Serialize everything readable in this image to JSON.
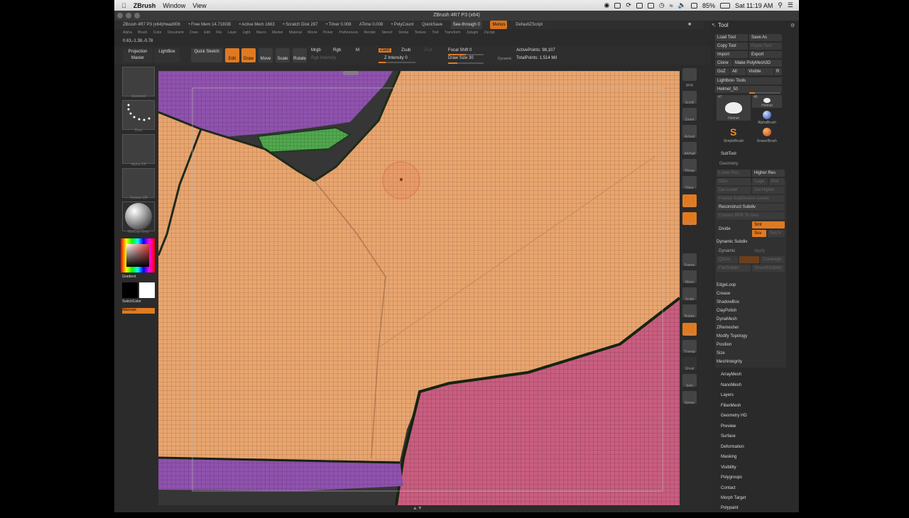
{
  "mac_menubar": {
    "app_name": "ZBrush",
    "menus": [
      "Window",
      "View"
    ],
    "battery": "85%",
    "clock": "Sat 11:19 AM"
  },
  "window": {
    "title": "ZBrush 4R7 P3 (x64)"
  },
  "infobar": {
    "version": "ZBrush 4R7 P3 (x64)Head006",
    "free_mem": "• Free Mem 14.718GB",
    "active_mem": "• Active Mem 1663",
    "scratch": "• Scratch Disk 287",
    "timer": "• Timer 0.008",
    "atime": "ATime 0.008",
    "polycount": "• PolyCount",
    "quicksave": "QuickSave",
    "see_through": "See-through 0",
    "menus_btn": "Menus",
    "default_script": "DefaultZScript"
  },
  "menus": [
    "Alpha",
    "Brush",
    "Color",
    "Document",
    "Draw",
    "Edit",
    "File",
    "Layer",
    "Light",
    "Macro",
    "Marker",
    "Material",
    "Movie",
    "Picker",
    "Preferences",
    "Render",
    "Stencil",
    "Stroke",
    "Texture",
    "Tool",
    "Transform",
    "Zplugin",
    "Zscript"
  ],
  "coords": "0.63,-1.38,-0.78",
  "shelf": {
    "projection_master": "Projection Master",
    "lightbox": "LightBox",
    "quick_sketch": "Quick Sketch",
    "edit": "Edit",
    "draw": "Draw",
    "move": "Move",
    "scale": "Scale",
    "rotate": "Rotate",
    "mrgb": "Mrgb",
    "rgb": "Rgb",
    "m": "M",
    "rgb_intensity": "Rgb Intensity",
    "zadd": "Zadd",
    "zsub": "Zsub",
    "zcut": "Zcut",
    "z_intensity": "Z Intensity 0",
    "focal_shift": "Focal Shift 0",
    "draw_size": "Draw Size 30",
    "dynamic": "Dynamic",
    "active_points": "ActivePoints: 98,107",
    "total_points": "TotalPoints: 1.514 Mil"
  },
  "left_tray": {
    "brush_caption": "Standard",
    "stroke_caption": "Dots",
    "alpha_caption": "Alpha Off",
    "texture_caption": "Texture Off",
    "material_caption": "MatCap Gray",
    "gradient": "Gradient",
    "switch_color": "SwitchColor",
    "alternate": "Alternate"
  },
  "right_shelf": [
    "BPR",
    "Scroll",
    "Zoom",
    "Actual",
    "AAHalf",
    "Persp",
    "Floor",
    "Local",
    "L.Sym",
    "Frame",
    "Move",
    "Scale",
    "Rotate",
    "PolyF",
    "Transp",
    "Ghost",
    "Solo",
    "Xpose"
  ],
  "tool_palette": {
    "title": "Tool",
    "load_tool": "Load Tool",
    "save_as": "Save As",
    "copy_tool": "Copy Tool",
    "paste_tool": "Paste Tool",
    "import": "Import",
    "export": "Export",
    "clone": "Clone",
    "make_polymesh": "Make PolyMesh3D",
    "goz": "GoZ",
    "all": "All",
    "visible": "Visible",
    "r": "R",
    "lightbox_tools": "Lightbox› Tools",
    "current_tool": "Helmet_50",
    "thumb_helmet": "Helmet",
    "thumb_helmet2": "Helmet",
    "thumb_alpha": "AlphaBrush",
    "thumb_simple": "SimpleBrush",
    "thumb_eraser": "EraserBrush",
    "thumb_count1": "47",
    "thumb_count2": "48",
    "subtool": "SubTool",
    "geometry": "Geometry",
    "lower_res": "Lower Res",
    "higher_res": "Higher Res",
    "sdiv": "SDiv",
    "cage": "Cage",
    "rstr": "Rstr",
    "del_lower": "Del Lower",
    "del_higher": "Del Higher",
    "freeze_subdiv": "Freeze SubDivision Levels",
    "reconstruct_subdiv": "Reconstruct Subdiv",
    "convert_bpr": "Convert BPR To Geo",
    "divide": "Divide",
    "smt": "Smt",
    "suv": "Suv",
    "reuv": "ReUV",
    "dynamic_subdiv": "Dynamic Subdiv",
    "dynamic": "Dynamic",
    "apply": "Apply",
    "qgrid": "QGrid",
    "coverage": "Coverage",
    "flatsubdiv": "FlatSubdiv",
    "smoothsubdiv": "SmoothSubdiv",
    "geometry_items": [
      "EdgeLoop",
      "Crease",
      "ShadowBox",
      "ClayPolish",
      "DynaMesh",
      "ZRemesher",
      "Modify Topology",
      "Position",
      "Size",
      "MeshIntegrity"
    ],
    "sections": [
      "ArrayMesh",
      "NanoMesh",
      "Layers",
      "FiberMesh",
      "Geometry HD",
      "Preview",
      "Surface",
      "Deformation",
      "Masking",
      "Visibility",
      "Polygroups",
      "Contact",
      "Morph Target",
      "Polypaint"
    ]
  },
  "colors": {
    "accent": "#e07a21",
    "skin": "#e6a26d",
    "purple": "#8a4fa8",
    "pink": "#c6587a",
    "green": "#4fa24e"
  }
}
